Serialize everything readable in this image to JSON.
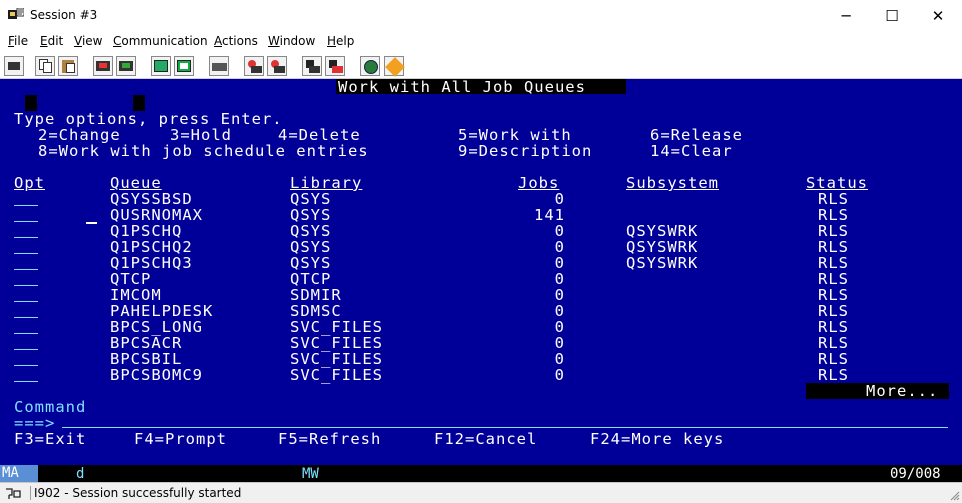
{
  "window": {
    "title": "Session #3",
    "minimize": "─",
    "maximize": "☐",
    "close": "✕"
  },
  "menu": {
    "items": [
      "File",
      "Edit",
      "View",
      "Communication",
      "Actions",
      "Window",
      "Help"
    ],
    "mnemonics": [
      "F",
      "E",
      "V",
      "C",
      "A",
      "W",
      "H"
    ]
  },
  "toolbar": {
    "icons": [
      "print-screen-icon",
      "copy-icon",
      "paste-icon",
      "send-file-icon",
      "receive-file-icon",
      "display-icon",
      "keypad-icon",
      "macro-icon",
      "record-macro-icon",
      "stop-macro-icon",
      "play-macro-icon",
      "play-stop-icon",
      "globe-icon",
      "help-icon"
    ]
  },
  "screen": {
    "title": "Work with All Job Queues",
    "instruction": "Type options, press Enter.",
    "options_line1": [
      "2=Change",
      "3=Hold",
      "4=Delete",
      "5=Work with",
      "6=Release"
    ],
    "options_line2": [
      "8=Work with job schedule entries",
      "9=Description",
      "14=Clear"
    ],
    "headers": {
      "opt": "Opt",
      "queue": "Queue",
      "library": "Library",
      "jobs": "Jobs",
      "subsystem": "Subsystem",
      "status": "Status"
    },
    "rows": [
      {
        "queue": "QSYSSBSD",
        "library": "QSYS",
        "jobs": "0",
        "subsystem": "",
        "status": "RLS"
      },
      {
        "queue": "QUSRNOMAX",
        "library": "QSYS",
        "jobs": "141",
        "subsystem": "",
        "status": "RLS"
      },
      {
        "queue": "Q1PSCHQ",
        "library": "QSYS",
        "jobs": "0",
        "subsystem": "QSYSWRK",
        "status": "RLS"
      },
      {
        "queue": "Q1PSCHQ2",
        "library": "QSYS",
        "jobs": "0",
        "subsystem": "QSYSWRK",
        "status": "RLS"
      },
      {
        "queue": "Q1PSCHQ3",
        "library": "QSYS",
        "jobs": "0",
        "subsystem": "QSYSWRK",
        "status": "RLS"
      },
      {
        "queue": "QTCP",
        "library": "QTCP",
        "jobs": "0",
        "subsystem": "",
        "status": "RLS"
      },
      {
        "queue": "IMCOM",
        "library": "SDMIR",
        "jobs": "0",
        "subsystem": "",
        "status": "RLS"
      },
      {
        "queue": "PAHELPDESK",
        "library": "SDMSC",
        "jobs": "0",
        "subsystem": "",
        "status": "RLS"
      },
      {
        "queue": "BPCS_LONG",
        "library": "SVC_FILES",
        "jobs": "0",
        "subsystem": "",
        "status": "RLS"
      },
      {
        "queue": "BPCSACR",
        "library": "SVC_FILES",
        "jobs": "0",
        "subsystem": "",
        "status": "RLS"
      },
      {
        "queue": "BPCSBIL",
        "library": "SVC_FILES",
        "jobs": "0",
        "subsystem": "",
        "status": "RLS"
      },
      {
        "queue": "BPCSBOMC9",
        "library": "SVC_FILES",
        "jobs": "0",
        "subsystem": "",
        "status": "RLS"
      }
    ],
    "more": "More...",
    "command_label": "Command",
    "command_prompt": "===>",
    "fkeys": [
      "F3=Exit",
      "F4=Prompt",
      "F5=Refresh",
      "F12=Cancel",
      "F24=More keys"
    ]
  },
  "oia": {
    "mode": "MA",
    "indicator": "d",
    "session": "MW",
    "cursor": "09/008"
  },
  "status": {
    "message": "I902 - Session successfully started"
  },
  "colors": {
    "screen_bg": "#000099",
    "oia_text": "#7fe0ff",
    "oia_mode_bg": "#5a8fd6"
  }
}
